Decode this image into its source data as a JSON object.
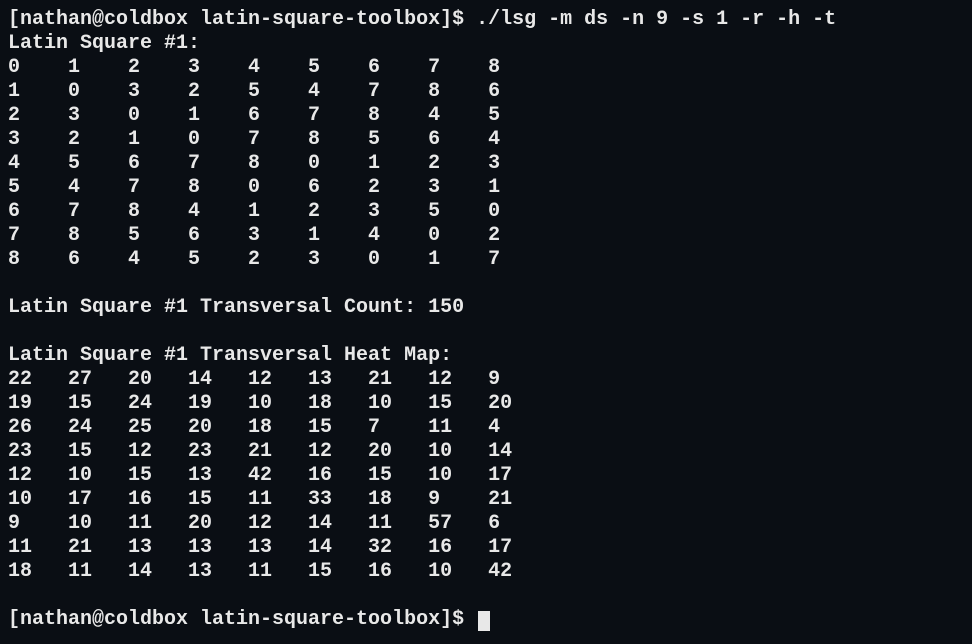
{
  "prompt1_prefix": "[nathan@coldbox latin-square-toolbox]$ ",
  "command": "./lsg -m ds -n 9 -s 1 -r -h -t",
  "square_header": "Latin Square #1:",
  "square": [
    [
      0,
      1,
      2,
      3,
      4,
      5,
      6,
      7,
      8
    ],
    [
      1,
      0,
      3,
      2,
      5,
      4,
      7,
      8,
      6
    ],
    [
      2,
      3,
      0,
      1,
      6,
      7,
      8,
      4,
      5
    ],
    [
      3,
      2,
      1,
      0,
      7,
      8,
      5,
      6,
      4
    ],
    [
      4,
      5,
      6,
      7,
      8,
      0,
      1,
      2,
      3
    ],
    [
      5,
      4,
      7,
      8,
      0,
      6,
      2,
      3,
      1
    ],
    [
      6,
      7,
      8,
      4,
      1,
      2,
      3,
      5,
      0
    ],
    [
      7,
      8,
      5,
      6,
      3,
      1,
      4,
      0,
      2
    ],
    [
      8,
      6,
      4,
      5,
      2,
      3,
      0,
      1,
      7
    ]
  ],
  "transversal_line": "Latin Square #1 Transversal Count: 150",
  "heatmap_header": "Latin Square #1 Transversal Heat Map:",
  "heatmap": [
    [
      22,
      27,
      20,
      14,
      12,
      13,
      21,
      12,
      9
    ],
    [
      19,
      15,
      24,
      19,
      10,
      18,
      10,
      15,
      20
    ],
    [
      26,
      24,
      25,
      20,
      18,
      15,
      7,
      11,
      4
    ],
    [
      23,
      15,
      12,
      23,
      21,
      12,
      20,
      10,
      14
    ],
    [
      12,
      10,
      15,
      13,
      42,
      16,
      15,
      10,
      17
    ],
    [
      10,
      17,
      16,
      15,
      11,
      33,
      18,
      9,
      21
    ],
    [
      9,
      10,
      11,
      20,
      12,
      14,
      11,
      57,
      6
    ],
    [
      11,
      21,
      13,
      13,
      13,
      14,
      32,
      16,
      17
    ],
    [
      18,
      11,
      14,
      13,
      11,
      15,
      16,
      10,
      42
    ]
  ],
  "prompt2_prefix": "[nathan@coldbox latin-square-toolbox]$ "
}
